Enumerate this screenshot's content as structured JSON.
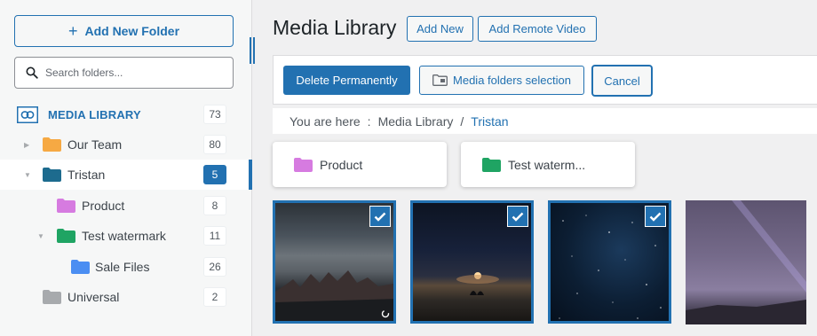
{
  "sidebar": {
    "add_folder_label": "Add New Folder",
    "search_placeholder": "Search folders...",
    "media_library": {
      "label": "MEDIA LIBRARY",
      "count": "73"
    },
    "items": [
      {
        "label": "Our Team",
        "count": "80",
        "color": "#f6a943"
      },
      {
        "label": "Tristan",
        "count": "5",
        "color": "#1d6b8e"
      },
      {
        "label": "Product",
        "count": "8",
        "color": "#d67be0"
      },
      {
        "label": "Test watermark",
        "count": "11",
        "color": "#1fa463"
      },
      {
        "label": "Sale Files",
        "count": "26",
        "color": "#4b8ef2"
      },
      {
        "label": "Universal",
        "count": "2",
        "color": "#a7aaad"
      }
    ]
  },
  "main": {
    "title": "Media Library",
    "add_new": "Add New",
    "add_remote_video": "Add Remote Video",
    "delete_permanently": "Delete Permanently",
    "media_folders_selection": "Media folders selection",
    "cancel": "Cancel",
    "breadcrumb": {
      "prefix": "You are here",
      "separator": ":",
      "root": "Media Library",
      "divider": "/",
      "current": "Tristan"
    },
    "subfolders": [
      {
        "label": "Product",
        "color": "#d67be0"
      },
      {
        "label": "Test waterm...",
        "color": "#1fa463"
      }
    ]
  },
  "colors": {
    "accent": "#2271b1"
  }
}
